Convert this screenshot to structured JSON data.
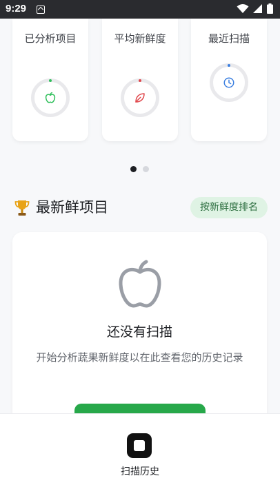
{
  "status_bar": {
    "time": "9:29"
  },
  "stats": [
    {
      "label": "已分析项目",
      "icon": "apple-icon",
      "dot_color": "#2fbf5b",
      "icon_color": "#2fbf5b"
    },
    {
      "label": "平均新鲜度",
      "icon": "leaf-icon",
      "dot_color": "#e0474c",
      "icon_color": "#e0474c"
    },
    {
      "label": "最近扫描",
      "icon": "clock-icon",
      "dot_color": "#3b7fe0",
      "icon_color": "#3b7fe0"
    }
  ],
  "pager": {
    "pages": 2,
    "active": 0
  },
  "section": {
    "title": "最新鲜项目",
    "icon": "trophy-icon",
    "sort_label": "按新鲜度排名"
  },
  "empty_state": {
    "title": "还没有扫描",
    "description": "开始分析蔬果新鲜度以在此查看您的历史记录",
    "icon": "apple-outline-icon"
  },
  "bottom_nav": {
    "items": [
      {
        "label": "扫描历史",
        "icon": "stop-square-icon"
      }
    ]
  },
  "colors": {
    "accent_green": "#27a84a",
    "badge_bg": "#dff3e4",
    "badge_text": "#2c6e3f"
  }
}
